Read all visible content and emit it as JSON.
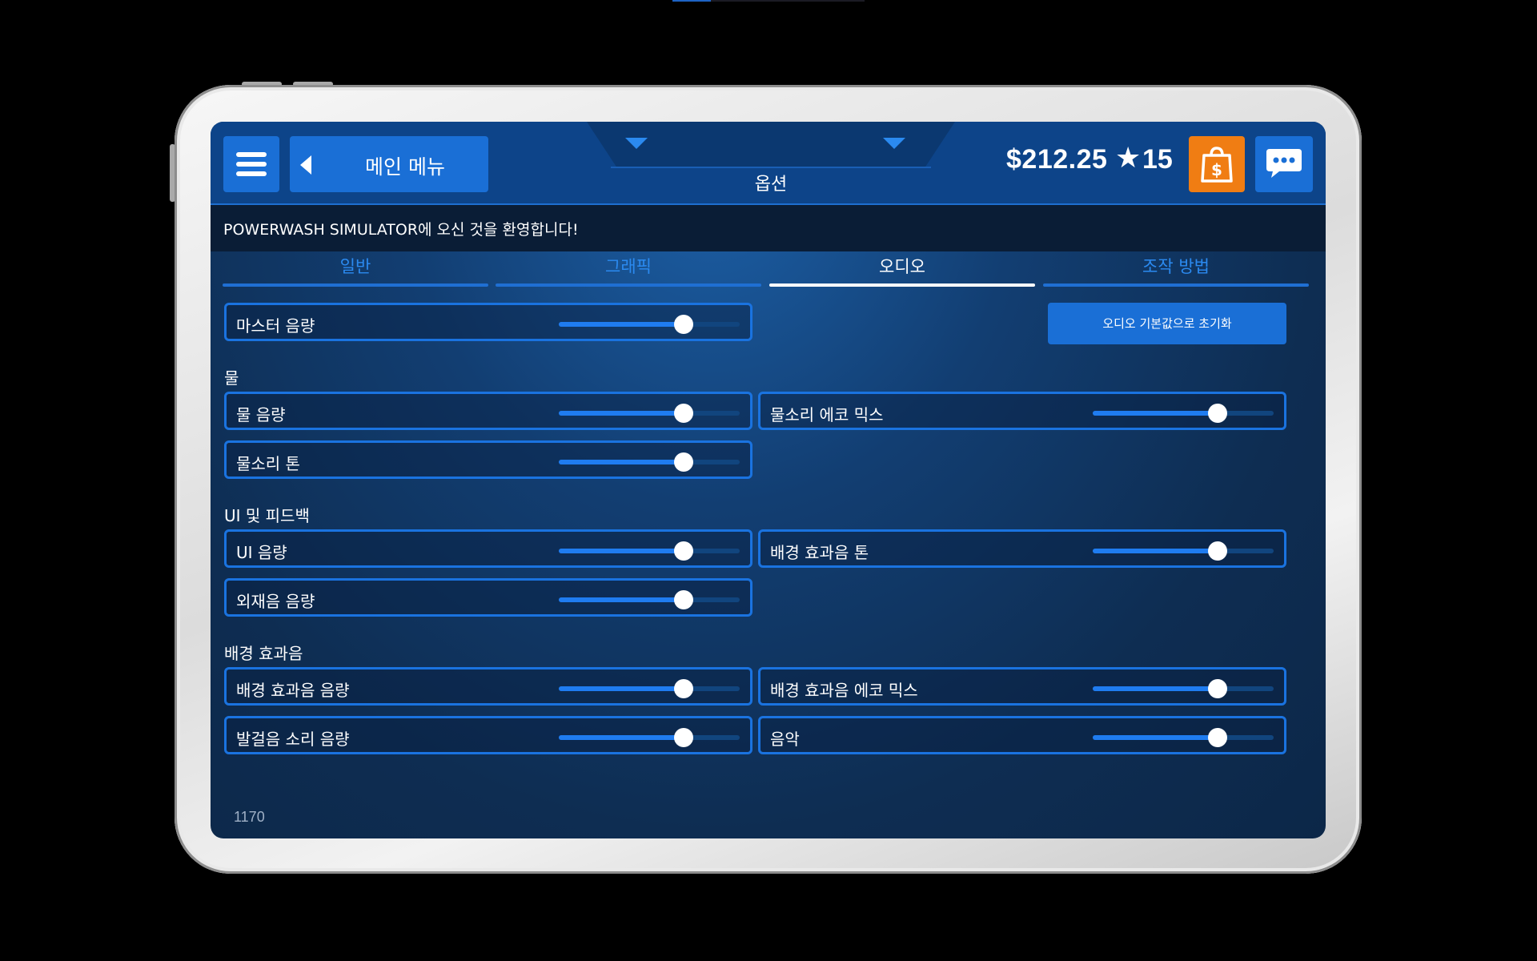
{
  "header": {
    "menu_icon": "hamburger-icon",
    "back_label": "메인 메뉴",
    "title": "옵션",
    "money": "$212.25",
    "stars": "15",
    "shop_icon": "shopping-bag-dollar-icon",
    "chat_icon": "chat-bubble-icon"
  },
  "welcome": "POWERWASH SIMULATOR에 오신 것을 환영합니다!",
  "tabs": [
    {
      "label": "일반",
      "active": false
    },
    {
      "label": "그래픽",
      "active": false
    },
    {
      "label": "오디오",
      "active": true
    },
    {
      "label": "조작 방법",
      "active": false
    }
  ],
  "reset_button": "오디오 기본값으로 초기화",
  "sections": {
    "water": "물",
    "ui_feedback": "UI 및 피드백",
    "ambience": "배경 효과음"
  },
  "sliders": {
    "master_volume": {
      "label": "마스터 음량",
      "value": 0.69
    },
    "water_volume": {
      "label": "물 음량",
      "value": 0.69
    },
    "water_echo_mix": {
      "label": "물소리 에코 믹스",
      "value": 0.69
    },
    "water_tone": {
      "label": "물소리 톤",
      "value": 0.69
    },
    "ui_volume": {
      "label": "UI 음량",
      "value": 0.69
    },
    "ambience_tone": {
      "label": "배경 효과음 톤",
      "value": 0.69
    },
    "outside_volume": {
      "label": "외재음 음량",
      "value": 0.69
    },
    "ambience_volume": {
      "label": "배경 효과음 음량",
      "value": 0.69
    },
    "ambience_echo_mix": {
      "label": "배경 효과음 에코 믹스",
      "value": 0.69
    },
    "footstep_volume": {
      "label": "발걸음 소리 음량",
      "value": 0.69
    },
    "music": {
      "label": "음악",
      "value": 0.69
    }
  },
  "build_number": "1170",
  "colors": {
    "accent": "#1a6fd6",
    "shop": "#f07d13",
    "active_tab": "#ffffff",
    "inactive_tab": "#2b8af0"
  }
}
